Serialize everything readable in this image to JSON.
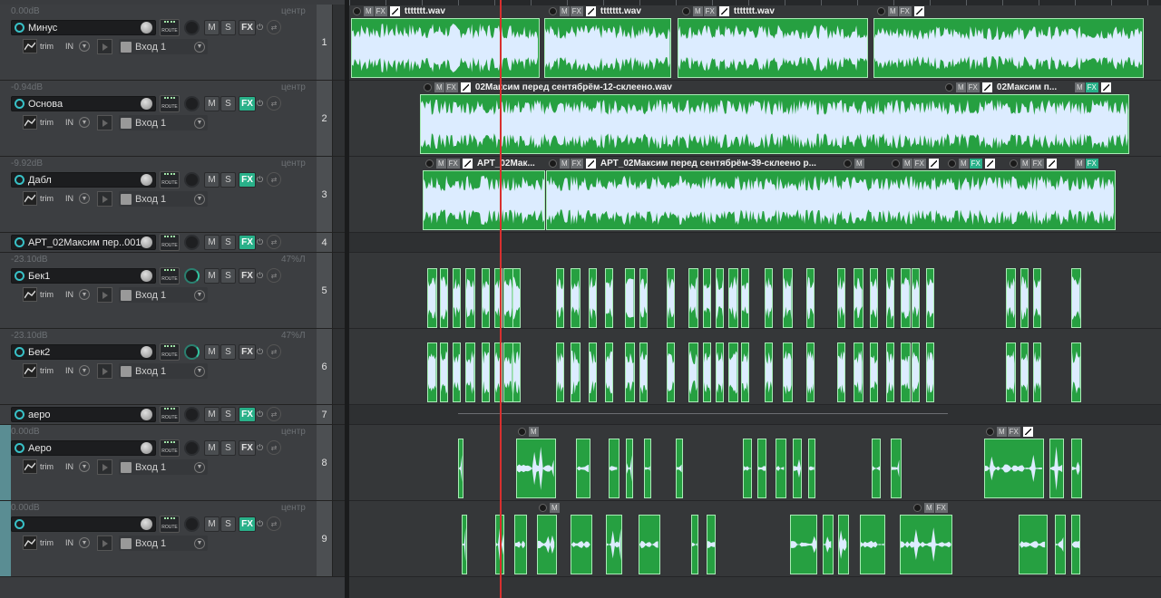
{
  "colors": {
    "accent_teal": "#29b089",
    "rec_arm": "#38c1c7",
    "item_fill": "#26a041",
    "waveform": "#dcecff",
    "cursor": "#d8302f"
  },
  "icons": {
    "rec_arm": "record-arm-icon",
    "volume": "volume-knob-icon",
    "route": "route-icon",
    "pan": "pan-knob-icon",
    "trim": "trim-envelope-icon",
    "input": "input-icon",
    "folder": "folder-icon",
    "item_envelope": "item-envelope-icon"
  },
  "labels": {
    "route": "ROUTE",
    "mute": "M",
    "solo": "S",
    "fx": "FX",
    "trim": "trim",
    "in": "IN"
  },
  "tracks": [
    {
      "num": "1",
      "name": "Минус",
      "vol": "0.00dB",
      "pan": "центр",
      "input": "Вход 1",
      "fx_on": false
    },
    {
      "num": "2",
      "name": "Основа",
      "vol": "-0.94dB",
      "pan": "центр",
      "input": "Вход 1",
      "fx_on": true
    },
    {
      "num": "3",
      "name": "Дабл",
      "vol": "-9.92dB",
      "pan": "центр",
      "input": "Вход 1",
      "fx_on": true
    },
    {
      "num": "4",
      "name": "АРТ_02Максим пер..001",
      "vol": "",
      "pan": "",
      "input": "",
      "fx_on": true
    },
    {
      "num": "5",
      "name": "Бек1",
      "vol": "-23.10dB",
      "pan": "47%Л",
      "input": "Вход 1",
      "fx_on": false
    },
    {
      "num": "6",
      "name": "Бек2",
      "vol": "-23.10dB",
      "pan": "47%Л",
      "input": "Вход 1",
      "fx_on": false
    },
    {
      "num": "7",
      "name": "аеро",
      "vol": "",
      "pan": "",
      "input": "",
      "fx_on": true
    },
    {
      "num": "8",
      "name": "Аеро",
      "vol": "0.00dB",
      "pan": "центр",
      "input": "Вход 1",
      "fx_on": false
    },
    {
      "num": "9",
      "name": "",
      "vol": "0.00dB",
      "pan": "центр",
      "input": "Вход 1",
      "fx_on": true
    }
  ],
  "item_headers": [
    {
      "name": "ttttttt.wav"
    },
    {
      "name": "ttttttt.wav"
    },
    {
      "name": "ttttttt.wav"
    },
    {
      "name": ""
    },
    {
      "name": "02Максим перед сентябрём-12-склеено.wav"
    },
    {
      "name": "02Максим п..."
    },
    {
      "name": "АРТ_02Мак..."
    },
    {
      "name": "АРТ_02Максим перед сентябрём-39-склеено р..."
    }
  ]
}
